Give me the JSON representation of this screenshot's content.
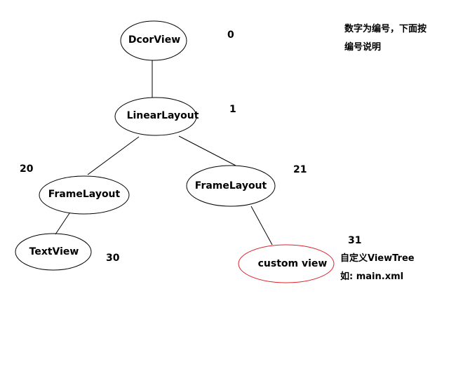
{
  "diagram": {
    "type": "tree",
    "title_note": [
      "数字为编号，下面按",
      "编号说明"
    ],
    "nodes": [
      {
        "id": "0",
        "label": "DcorView",
        "number": "0",
        "parent": null,
        "highlight": false
      },
      {
        "id": "1",
        "label": "LinearLayout",
        "number": "1",
        "parent": "0",
        "highlight": false
      },
      {
        "id": "20",
        "label": "FrameLayout",
        "number": "20",
        "parent": "1",
        "highlight": false
      },
      {
        "id": "21",
        "label": "FrameLayout",
        "number": "21",
        "parent": "1",
        "highlight": false
      },
      {
        "id": "30",
        "label": "TextView",
        "number": "30",
        "parent": "20",
        "highlight": false
      },
      {
        "id": "31",
        "label": "custom view",
        "number": "31",
        "parent": "21",
        "highlight": true
      }
    ],
    "custom_note": [
      "自定义ViewTree",
      "如: main.xml"
    ],
    "colors": {
      "node_stroke": "#000000",
      "highlight_stroke": "#e0202a",
      "edge": "#000000",
      "text": "#000000"
    }
  }
}
